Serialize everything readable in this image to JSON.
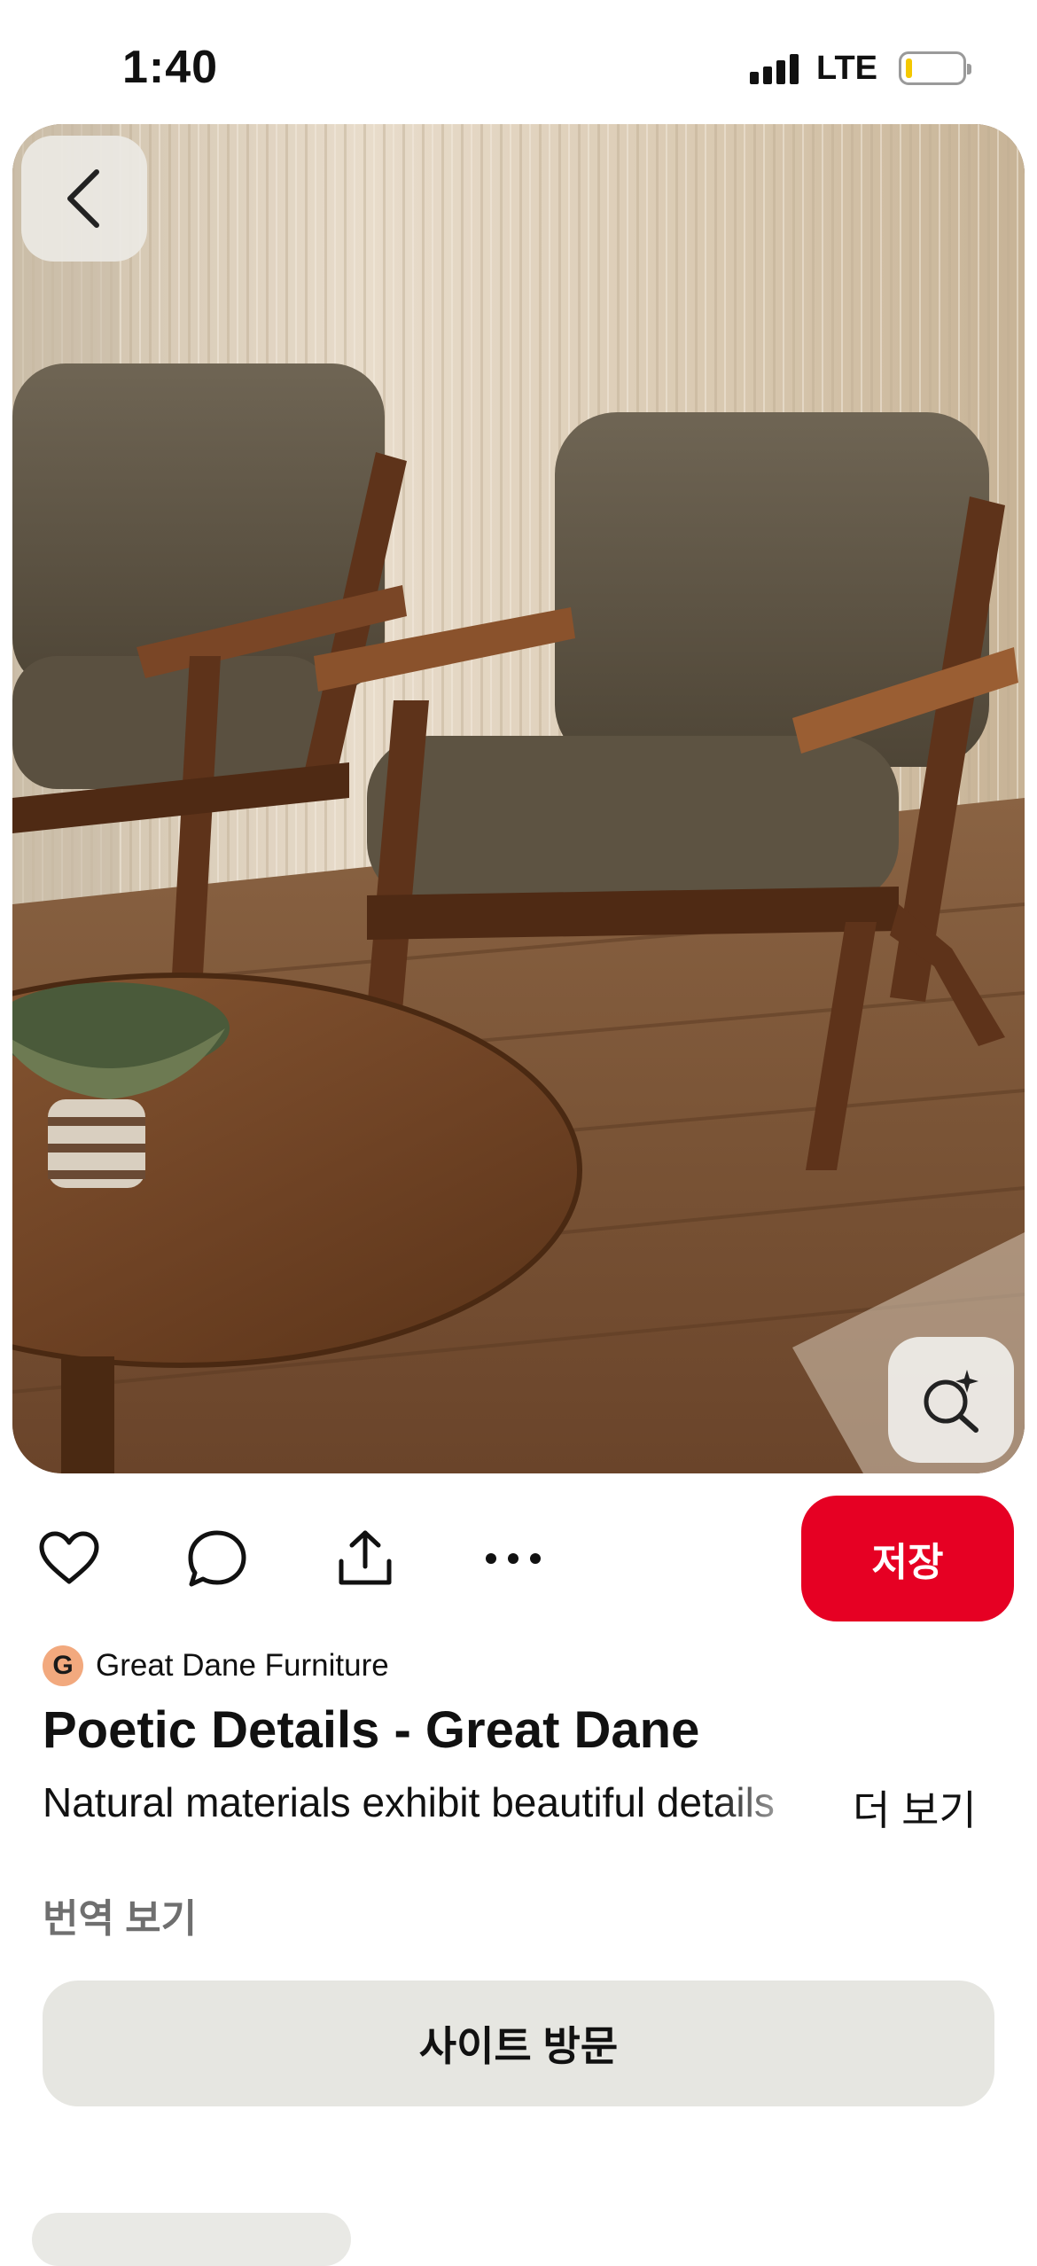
{
  "status_bar": {
    "time": "1:40",
    "network": "LTE",
    "battery_level": 0.1
  },
  "pin": {
    "image_description_icon": "photo",
    "back_icon": "chevron-left-icon",
    "visual_search_icon": "sparkle-search-icon"
  },
  "actions": {
    "icons": [
      "heart-icon",
      "comment-icon",
      "share-icon",
      "more-icon"
    ],
    "save_label": "저장",
    "save_color": "#e60023"
  },
  "creator": {
    "initial": "G",
    "name": "Great Dane Furniture",
    "avatar_color": "#f2a97e"
  },
  "title": "Poetic Details - Great Dane",
  "description": "Natural materials exhibit beautiful details",
  "more_label": "더 보기",
  "translate_label": "번역 보기",
  "visit_site_label": "사이트 방문"
}
